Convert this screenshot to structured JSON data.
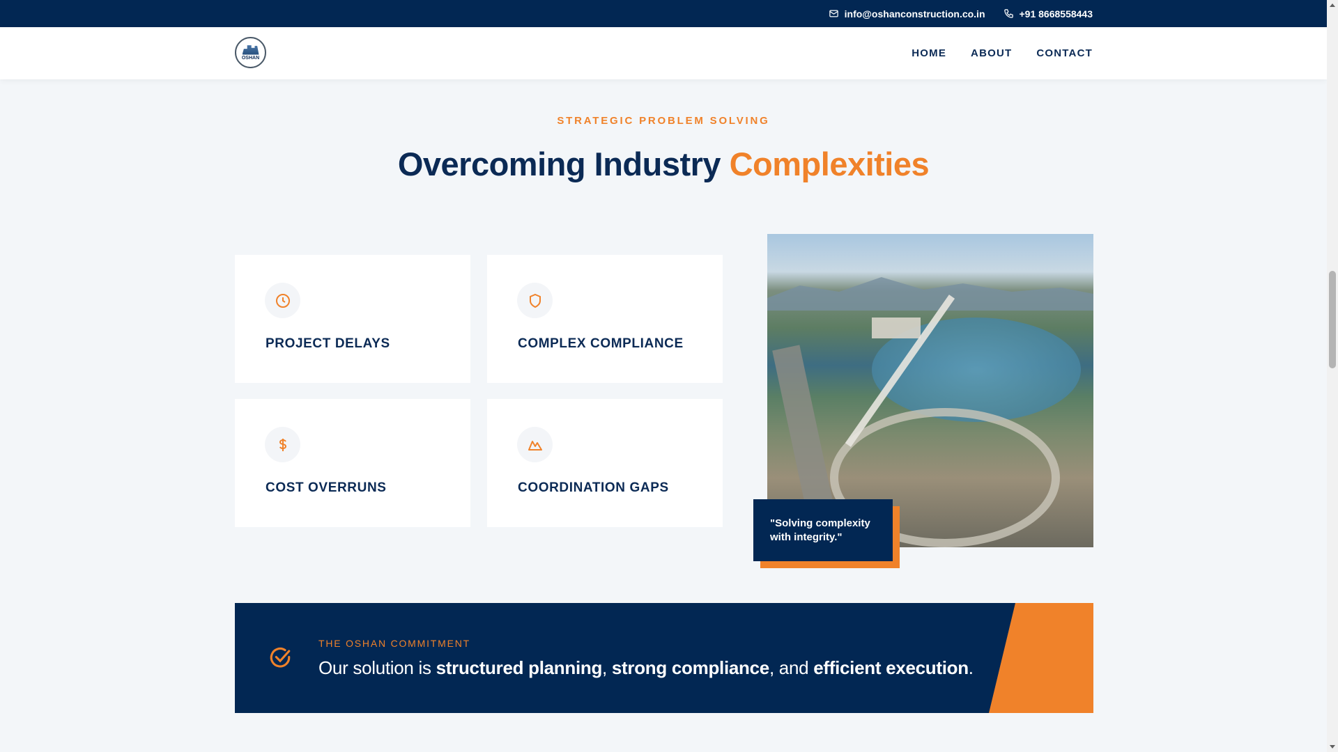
{
  "topbar": {
    "email": "info@oshanconstruction.co.in",
    "phone": "+91 8668558443"
  },
  "nav": {
    "logo_text": "OSHAN",
    "items": [
      {
        "label": "HOME"
      },
      {
        "label": "ABOUT"
      },
      {
        "label": "CONTACT"
      }
    ]
  },
  "section": {
    "eyebrow": "STRATEGIC PROBLEM SOLVING",
    "title_main": "Overcoming Industry ",
    "title_accent": "Complexities"
  },
  "cards": [
    {
      "label": "PROJECT DELAYS",
      "icon": "clock-icon"
    },
    {
      "label": "COMPLEX COMPLIANCE",
      "icon": "shield-icon"
    },
    {
      "label": "COST OVERRUNS",
      "icon": "dollar-icon"
    },
    {
      "label": "COORDINATION GAPS",
      "icon": "mountain-icon"
    }
  ],
  "quote": {
    "line1": "\"Solving complexity",
    "line2": "with integrity.\""
  },
  "commitment": {
    "eyebrow": "THE OSHAN COMMITMENT",
    "part1": "Our solution is ",
    "bold1": "structured planning",
    "part2": ", ",
    "bold2": "strong compliance",
    "part3": ", and ",
    "bold3": "efficient execution",
    "part4": "."
  },
  "colors": {
    "navy": "#022753",
    "orange": "#f0822a",
    "background": "#f3f6f9"
  }
}
